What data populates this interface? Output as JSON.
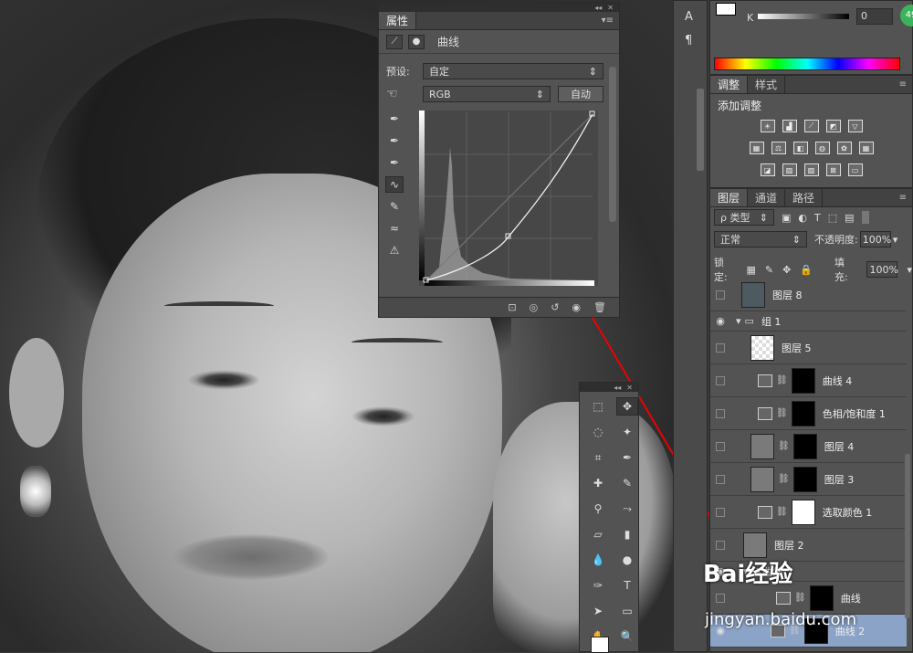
{
  "properties": {
    "tab": "属性",
    "title": "曲线",
    "preset_label": "预设:",
    "preset_value": "自定",
    "channel_value": "RGB",
    "auto_label": "自动"
  },
  "color_panel": {
    "channel_label": "K",
    "value": "0",
    "badge": "49"
  },
  "adjustments": {
    "tabs": [
      "调整",
      "样式"
    ],
    "heading": "添加调整"
  },
  "side_strip": {
    "char_icon": "A",
    "para_icon": "¶"
  },
  "layers_panel": {
    "tabs": [
      "图层",
      "通道",
      "路径"
    ],
    "filter_label": "ρ 类型",
    "blend_mode": "正常",
    "opacity_label": "不透明度:",
    "opacity_value": "100%",
    "lock_label": "锁定:",
    "fill_label": "填充:",
    "fill_value": "100%",
    "layers": [
      {
        "name": "图层 8",
        "thumb": "photo",
        "visible": false,
        "indent": 0
      },
      {
        "name": "组 1",
        "thumb": "folder",
        "visible": true,
        "indent": 0
      },
      {
        "name": "图层 5",
        "thumb": "check",
        "visible": false,
        "indent": 1
      },
      {
        "name": "曲线 4",
        "thumb": "adj",
        "mask": "black",
        "visible": false,
        "indent": 1
      },
      {
        "name": "色相/饱和度 1",
        "thumb": "adj",
        "mask": "black",
        "visible": false,
        "indent": 1
      },
      {
        "name": "图层 4",
        "thumb": "gray",
        "mask": "black",
        "visible": false,
        "indent": 1
      },
      {
        "name": "图层 3",
        "thumb": "gray",
        "mask": "black",
        "visible": false,
        "indent": 1
      },
      {
        "name": "选取颜色 1",
        "thumb": "adj",
        "mask": "white",
        "visible": false,
        "indent": 1
      },
      {
        "name": "图层 2",
        "thumb": "gray",
        "visible": false,
        "indent": 1
      },
      {
        "name": "X曲线",
        "thumb": "folder",
        "visible": true,
        "indent": 1
      },
      {
        "name": "曲线",
        "thumb": "adj",
        "mask": "black",
        "visible": false,
        "indent": 2
      },
      {
        "name": "曲线 2",
        "thumb": "adj",
        "mask": "black",
        "visible": true,
        "indent": 2,
        "selected": true
      }
    ]
  },
  "watermark": {
    "logo": "Bai经验",
    "url": "jingyan.baidu.com"
  }
}
